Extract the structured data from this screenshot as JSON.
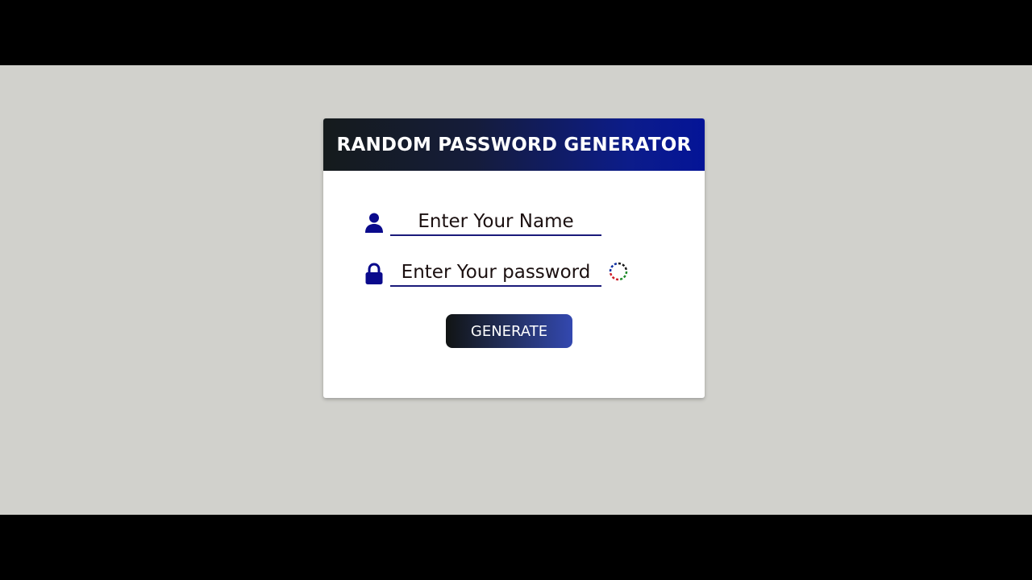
{
  "card": {
    "title": "RANDOM PASSWORD GENERATOR"
  },
  "name_field": {
    "placeholder": "Enter Your Name",
    "value": "",
    "icon": "user-icon"
  },
  "password_field": {
    "placeholder": "Enter Your password",
    "value": "",
    "icon": "lock-icon"
  },
  "spinner": {
    "icon": "loading-spinner-icon"
  },
  "generate_button": {
    "label": "GENERATE"
  },
  "colors": {
    "accent": "#0c1c8a",
    "icon": "#0a0a8c",
    "page_background": "#d1d1cc"
  }
}
